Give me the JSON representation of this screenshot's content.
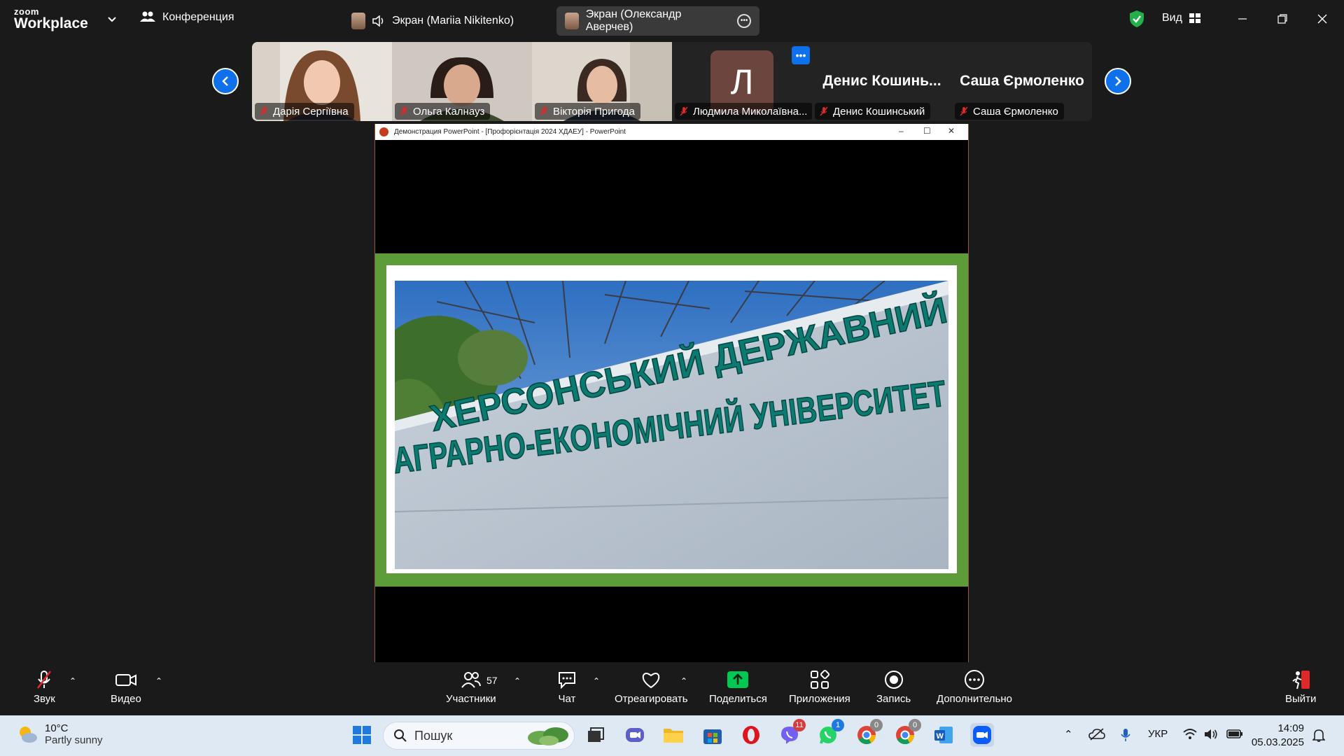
{
  "app": {
    "logo_small": "zoom",
    "logo_big": "Workplace",
    "meeting_label": "Конференция",
    "screen_tabs": [
      "Экран (Mariia Nikitenko)",
      "Экран (Олександр Аверчев)"
    ],
    "view_label": "Вид"
  },
  "participants": [
    {
      "name": "Дарія Сергіївна",
      "muted": true
    },
    {
      "name": "Ольга Калнауз",
      "muted": true
    },
    {
      "name": "Вікторія Пригода",
      "muted": true
    },
    {
      "name": "Людмила Миколаївна...",
      "initial": "Л",
      "muted": true
    },
    {
      "name": "Денис Кошинський",
      "display": "Денис Кошинь...",
      "muted": true
    },
    {
      "name": "Саша Єрмоленко",
      "display": "Саша Єрмоленко",
      "muted": true
    }
  ],
  "shared_window": {
    "title": "Демонстрация PowerPoint - [Профорієнтація 2024 ХДАЕУ] - PowerPoint",
    "sign_line1": "ХЕРСОНСЬКИЙ ДЕРЖАВНИЙ",
    "sign_line2": "АГРАРНО-ЕКОНОМІЧНИЙ УНІВЕРСИТЕТ"
  },
  "toolbar": {
    "audio": "Звук",
    "video": "Видео",
    "participants": "Участники",
    "participants_count": "57",
    "chat": "Чат",
    "react": "Отреагировать",
    "share": "Поделиться",
    "apps": "Приложения",
    "record": "Запись",
    "more": "Дополнительно",
    "leave": "Выйти"
  },
  "taskbar": {
    "temperature": "10°C",
    "weather": "Partly sunny",
    "search_placeholder": "Пошук",
    "badge_viber": "11",
    "badge_whatsapp": "1",
    "badge_chrome1": "0",
    "badge_chrome2": "0",
    "language": "УКР",
    "time": "14:09",
    "date": "05.03.2025"
  },
  "colors": {
    "accent_blue": "#0e71eb",
    "share_green": "#00c853",
    "slide_green": "#5d9c39",
    "muted_red": "#e02828"
  }
}
